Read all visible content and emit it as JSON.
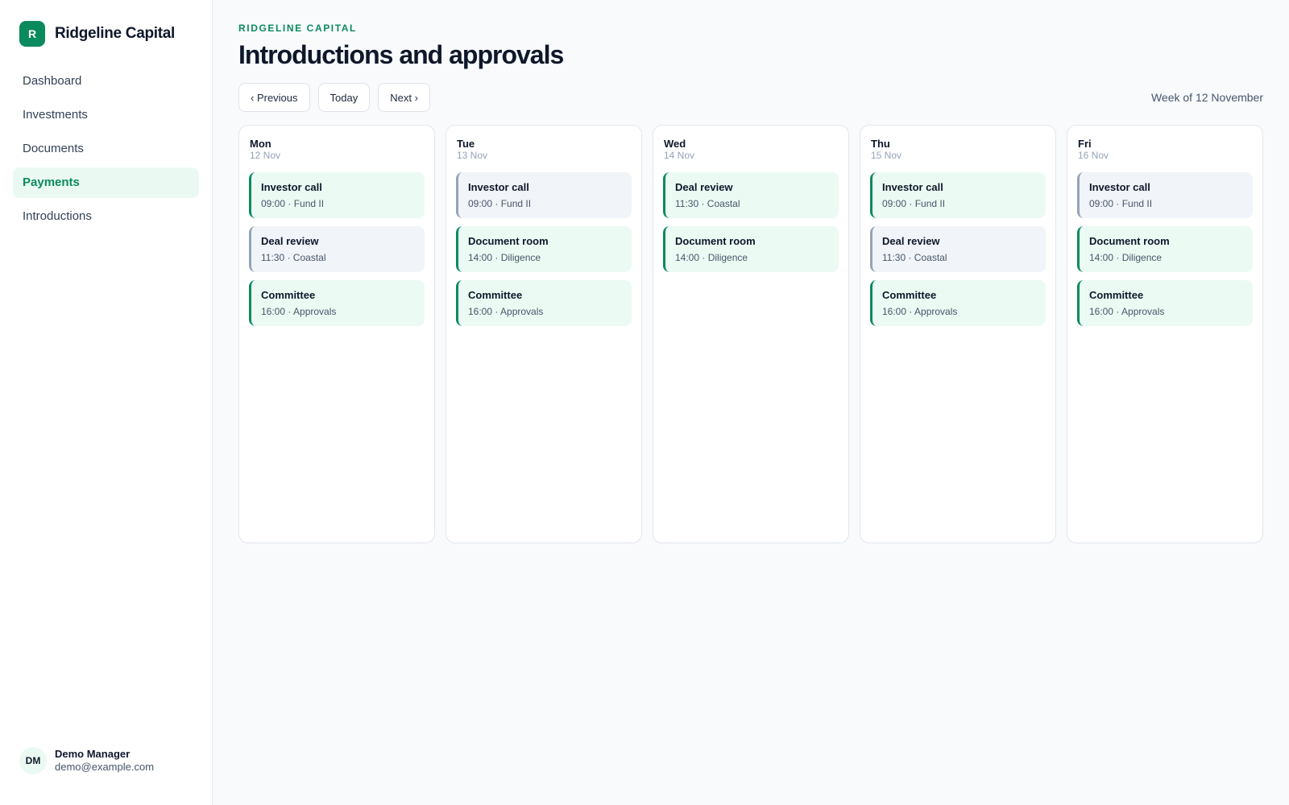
{
  "sidebar": {
    "brand": {
      "logo_letter": "R",
      "name": "Ridgeline Capital"
    },
    "items": [
      {
        "label": "Dashboard",
        "active": false
      },
      {
        "label": "Investments",
        "active": false
      },
      {
        "label": "Documents",
        "active": false
      },
      {
        "label": "Payments",
        "active": true
      },
      {
        "label": "Introductions",
        "active": false
      }
    ],
    "user": {
      "initials": "DM",
      "name": "Demo Manager",
      "email": "demo@example.com"
    }
  },
  "header": {
    "eyebrow": "RIDGELINE CAPITAL",
    "title": "Introductions and approvals"
  },
  "toolbar": {
    "previous_label": "‹ Previous",
    "today_label": "Today",
    "next_label": "Next ›",
    "week_label": "Week of 12 November"
  },
  "days": [
    {
      "name": "Mon",
      "date": "12 Nov",
      "events": [
        {
          "title": "Investor call",
          "meta": "09:00 · Fund II",
          "tone": "green"
        },
        {
          "title": "Deal review",
          "meta": "11:30 · Coastal",
          "tone": "grey"
        },
        {
          "title": "Committee",
          "meta": "16:00 · Approvals",
          "tone": "green"
        }
      ]
    },
    {
      "name": "Tue",
      "date": "13 Nov",
      "events": [
        {
          "title": "Investor call",
          "meta": "09:00 · Fund II",
          "tone": "grey"
        },
        {
          "title": "Document room",
          "meta": "14:00 · Diligence",
          "tone": "green"
        },
        {
          "title": "Committee",
          "meta": "16:00 · Approvals",
          "tone": "green"
        }
      ]
    },
    {
      "name": "Wed",
      "date": "14 Nov",
      "events": [
        {
          "title": "Deal review",
          "meta": "11:30 · Coastal",
          "tone": "green"
        },
        {
          "title": "Document room",
          "meta": "14:00 · Diligence",
          "tone": "green"
        }
      ]
    },
    {
      "name": "Thu",
      "date": "15 Nov",
      "events": [
        {
          "title": "Investor call",
          "meta": "09:00 · Fund II",
          "tone": "green"
        },
        {
          "title": "Deal review",
          "meta": "11:30 · Coastal",
          "tone": "grey"
        },
        {
          "title": "Committee",
          "meta": "16:00 · Approvals",
          "tone": "green"
        }
      ]
    },
    {
      "name": "Fri",
      "date": "16 Nov",
      "events": [
        {
          "title": "Investor call",
          "meta": "09:00 · Fund II",
          "tone": "grey"
        },
        {
          "title": "Document room",
          "meta": "14:00 · Diligence",
          "tone": "green"
        },
        {
          "title": "Committee",
          "meta": "16:00 · Approvals",
          "tone": "green"
        }
      ]
    }
  ],
  "colors": {
    "accent": "#0b8a5e",
    "accent_soft": "#eafaf2",
    "event_green_bg": "#ebfbf3",
    "event_grey_bg": "#f1f4f8",
    "event_grey_border": "#94a3b8"
  }
}
